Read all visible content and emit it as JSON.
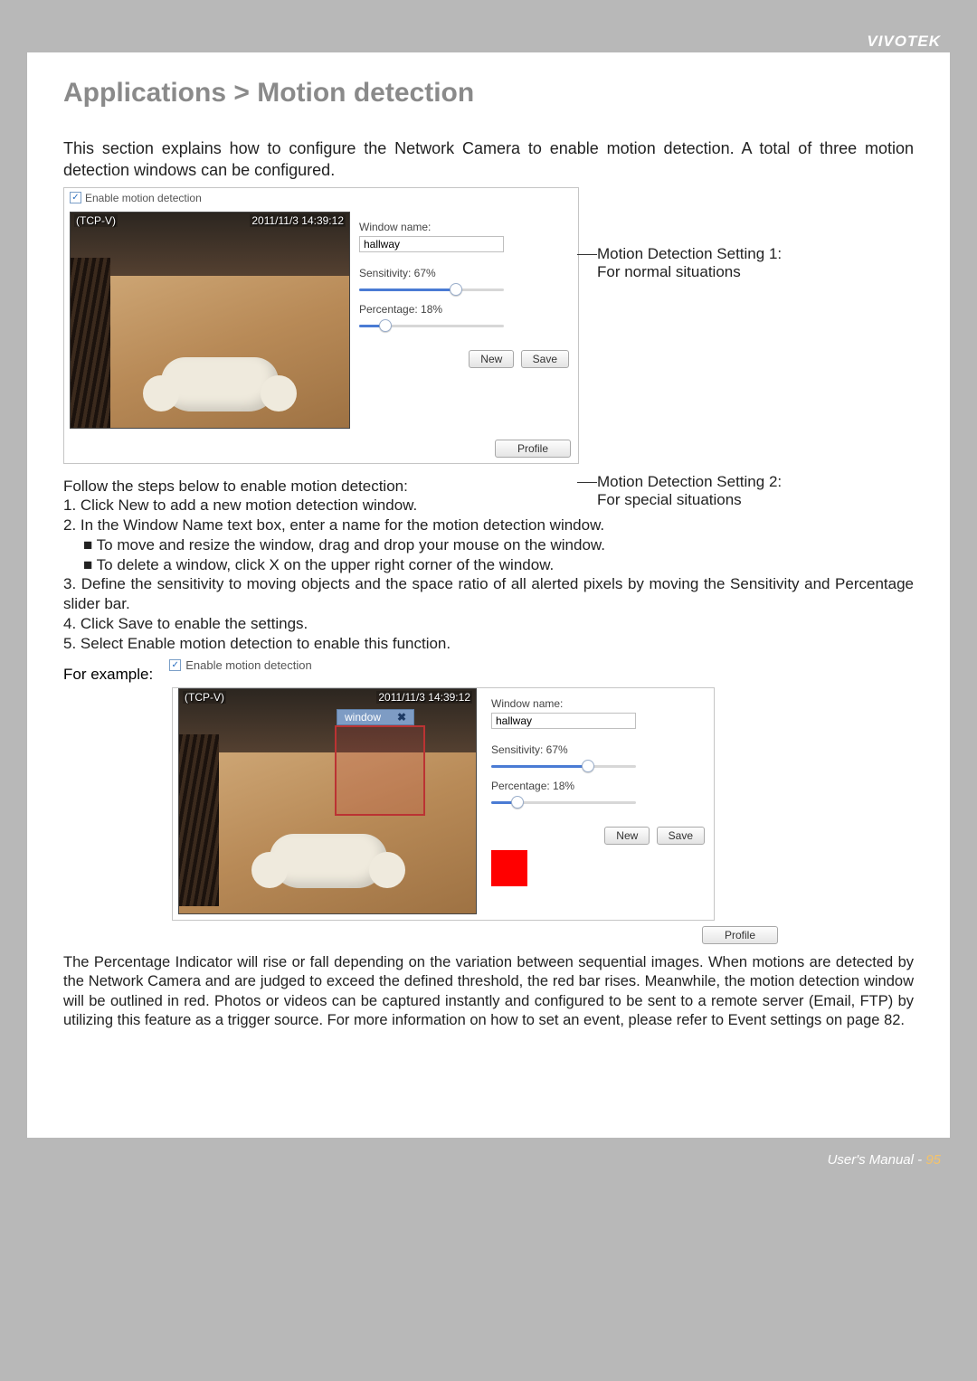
{
  "brand": "VIVOTEK",
  "title": "Applications > Motion detection",
  "intro": "This section explains how to configure the Network Camera to enable motion detection. A total of three motion detection windows can be configured.",
  "enable_label": "Enable motion detection",
  "osd": {
    "left": "(TCP-V)",
    "right": "2011/11/3 14:39:12"
  },
  "controls": {
    "winname_label": "Window name:",
    "winname_value": "hallway",
    "sensitivity_label": "Sensitivity: 67%",
    "sensitivity_pct": 67,
    "percentage_label": "Percentage: 18%",
    "percentage_pct": 18,
    "new_btn": "New",
    "save_btn": "Save",
    "profile_btn": "Profile"
  },
  "sidenote1a": "Motion Detection Setting 1:",
  "sidenote1b": "For normal situations",
  "sidenote2a": "Motion Detection Setting 2:",
  "sidenote2b": "For special situations",
  "steps_intro": "Follow the steps below to enable motion detection:",
  "steps": {
    "s1": "1. Click New to add a new motion detection window.",
    "s2": "2. In the Window Name text box, enter a name for the motion detection window.",
    "s2a": "■ To move and resize the window, drag and drop your mouse on the window.",
    "s2b": "■ To delete a window, click X on the upper right corner of the window.",
    "s3": "3. Define the sensitivity to moving objects and the space ratio of all alerted pixels by moving the Sensitivity and Percentage slider bar.",
    "s4": "4. Click Save to enable the settings.",
    "s5": "5. Select Enable motion detection   to enable this function."
  },
  "example_label": "For example:",
  "md_window_label": "window",
  "md_close": "✖",
  "paragraph": "The Percentage Indicator will rise or fall depending on the variation between sequential images. When motions are detected by the Network Camera and are judged to exceed the defined threshold, the red bar rises. Meanwhile, the motion detection window will be outlined in red. Photos or videos can be captured instantly and configured to be sent to a remote server (Email, FTP) by utilizing this feature as a trigger source. For more information on how to set an event, please refer to Event settings on page 82.",
  "footer_a": "User's Manual - ",
  "footer_page": "95"
}
